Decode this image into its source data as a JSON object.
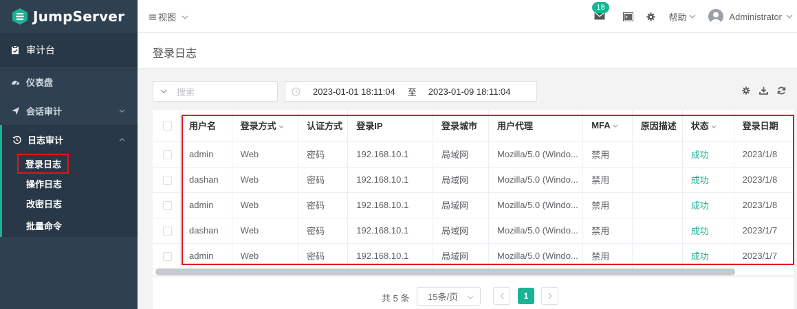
{
  "app": {
    "brand": "JumpServer",
    "accent": "#1ab394",
    "highlight": "#e0141c"
  },
  "sidebar": {
    "console_label": "审计台",
    "items": [
      {
        "label": "仪表盘",
        "icon": "dashboard-icon"
      },
      {
        "label": "会话审计",
        "icon": "paper-plane-icon"
      },
      {
        "label": "日志审计",
        "icon": "history-icon"
      }
    ],
    "sub_items": [
      "登录日志",
      "操作日志",
      "改密日志",
      "批量命令"
    ]
  },
  "topbar": {
    "view_label": "视图",
    "mail_badge": "18",
    "help_label": "帮助",
    "user_name": "Administrator"
  },
  "page": {
    "title": "登录日志"
  },
  "toolbar": {
    "search_placeholder": "搜索",
    "date_start": "2023-01-01 18:11:04",
    "date_separator": "至",
    "date_end": "2023-01-09 18:11:04"
  },
  "table": {
    "columns": [
      "用户名",
      "登录方式",
      "认证方式",
      "登录IP",
      "登录城市",
      "用户代理",
      "MFA",
      "原因描述",
      "状态",
      "登录日期"
    ],
    "rows": [
      [
        "admin",
        "Web",
        "密码",
        "192.168.10.1",
        "局域网",
        "Mozilla/5.0 (Windo...",
        "禁用",
        "",
        "成功",
        "2023/1/8"
      ],
      [
        "dashan",
        "Web",
        "密码",
        "192.168.10.1",
        "局域网",
        "Mozilla/5.0 (Windo...",
        "禁用",
        "",
        "成功",
        "2023/1/8"
      ],
      [
        "admin",
        "Web",
        "密码",
        "192.168.10.1",
        "局域网",
        "Mozilla/5.0 (Windo...",
        "禁用",
        "",
        "成功",
        "2023/1/8"
      ],
      [
        "dashan",
        "Web",
        "密码",
        "192.168.10.1",
        "局域网",
        "Mozilla/5.0 (Windo...",
        "禁用",
        "",
        "成功",
        "2023/1/7"
      ],
      [
        "admin",
        "Web",
        "密码",
        "192.168.10.1",
        "局域网",
        "Mozilla/5.0 (Windo...",
        "禁用",
        "",
        "成功",
        "2023/1/7"
      ]
    ]
  },
  "pagination": {
    "total_text": "共 5 条",
    "page_size": "15条/页",
    "current_page": "1"
  }
}
